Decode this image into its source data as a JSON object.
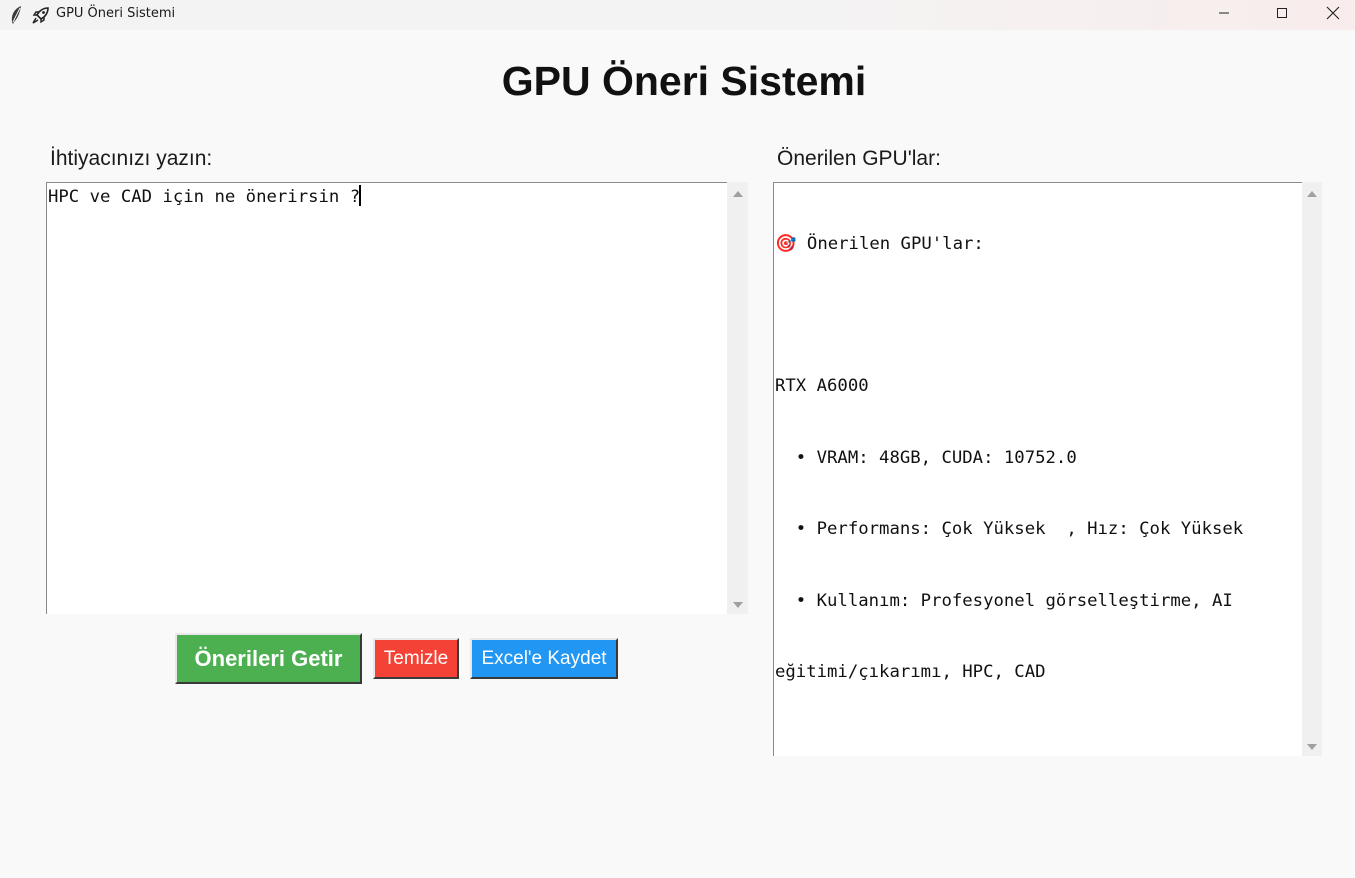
{
  "window": {
    "title": "GPU Öneri Sistemi",
    "controls": {
      "minimize": "minimize",
      "maximize": "maximize",
      "close": "close"
    }
  },
  "app": {
    "heading": "GPU Öneri Sistemi",
    "input_label": "İhtiyacınızı yazın:",
    "input_value": "HPC ve CAD için ne önerirsin ?",
    "output_label": "Önerilen GPU'lar:",
    "output_lines": [
      "🎯 Önerilen GPU'lar:",
      "",
      "RTX A6000",
      "  • VRAM: 48GB, CUDA: 10752.0",
      "  • Performans: Çok Yüksek  , Hız: Çok Yüksek",
      "  • Kullanım: Profesyonel görselleştirme, AI",
      "eğitimi/çıkarımı, HPC, CAD"
    ],
    "buttons": {
      "get": "Önerileri Getir",
      "clear": "Temizle",
      "excel": "Excel'e Kaydet"
    }
  },
  "colors": {
    "get_button": "#4caf50",
    "clear_button": "#f44336",
    "excel_button": "#2196f3"
  }
}
